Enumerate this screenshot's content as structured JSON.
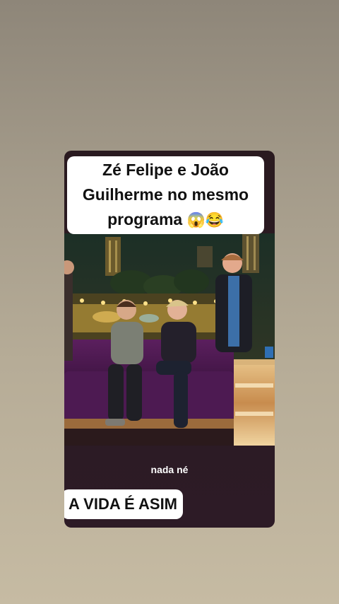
{
  "caption": {
    "lines": [
      "Zé Felipe e João",
      "Guilherme no mesmo",
      "programa"
    ],
    "emoji": "😱😂"
  },
  "subtitle": "nada né",
  "bottom_caption": "A VIDA É ASIM"
}
